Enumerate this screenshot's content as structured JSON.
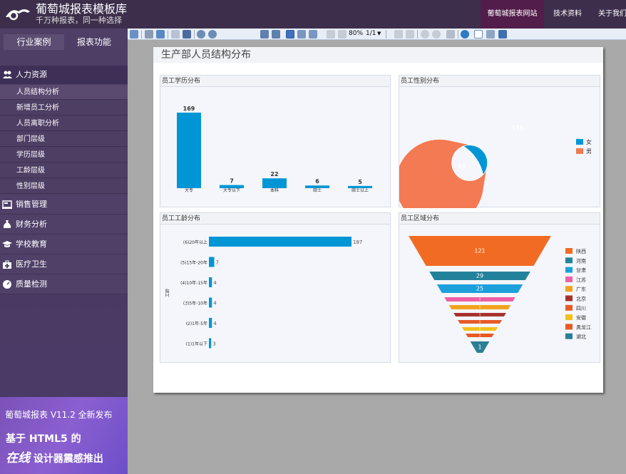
{
  "header": {
    "brand": "葡萄城报表模板库",
    "slogan": "千万种报表，同一种选择",
    "nav": [
      "葡萄城报表网站",
      "技术资料",
      "关于我们"
    ]
  },
  "sidebar": {
    "tabs": [
      "行业案例",
      "报表功能"
    ],
    "active_group": {
      "label": "人力资源",
      "items": [
        "人员结构分析",
        "新增员工分析",
        "人员离职分析",
        "部门层级",
        "学历层级",
        "工龄层级",
        "性别层级"
      ]
    },
    "groups": [
      "销售管理",
      "财务分析",
      "学校教育",
      "医疗卫生",
      "质量检测"
    ]
  },
  "promo": {
    "line1": "葡萄城报表 V11.2 全新发布",
    "line2": "基于 HTML5 的",
    "line3_em": "在线",
    "line3": " 设计器震感推出"
  },
  "toolbar": {
    "zoom": "80%",
    "page": "1/1"
  },
  "report": {
    "title": "生产部人员结构分布"
  },
  "panels": {
    "education": "员工学历分布",
    "gender": "员工性别分布",
    "tenure": "员工工龄分布",
    "region": "员工区域分布"
  },
  "chart_data": [
    {
      "type": "bar",
      "title": "员工学历分布",
      "categories": [
        "大专",
        "大专以下",
        "本科",
        "硕士",
        "硕士以上"
      ],
      "values": [
        169,
        7,
        22,
        6,
        5
      ],
      "color": "#0096d6"
    },
    {
      "type": "pie",
      "title": "员工性别分布",
      "categories": [
        "女",
        "男"
      ],
      "values": [
        54,
        155
      ],
      "colors": [
        "#0096d6",
        "#f37a52"
      ],
      "legend": "right"
    },
    {
      "type": "bar",
      "title": "员工工龄分布",
      "orientation": "horizontal",
      "ylabel": "工龄",
      "categories": [
        "(6)20年以上",
        "(5)15年-20年",
        "(4)10年-15年",
        "(3)5年-10年",
        "(2)1年-5年",
        "(1)1年以下"
      ],
      "values": [
        187,
        7,
        4,
        4,
        4,
        3
      ],
      "color": "#0096d6"
    },
    {
      "type": "funnel",
      "title": "员工区域分布",
      "categories": [
        "陕西",
        "河南",
        "甘肃",
        "江苏",
        "广东",
        "北京",
        "四川",
        "安徽",
        "黑龙江",
        "湖北"
      ],
      "values": [
        121,
        29,
        25,
        1,
        1,
        1,
        1,
        1,
        1,
        1
      ],
      "colors": [
        "#f26b22",
        "#23829b",
        "#1ba0db",
        "#ee5fa6",
        "#f3a21e",
        "#a8322e",
        "#e85b2a",
        "#f3c01a",
        "#e85a24",
        "#2a7f94"
      ],
      "legend": "right"
    }
  ]
}
